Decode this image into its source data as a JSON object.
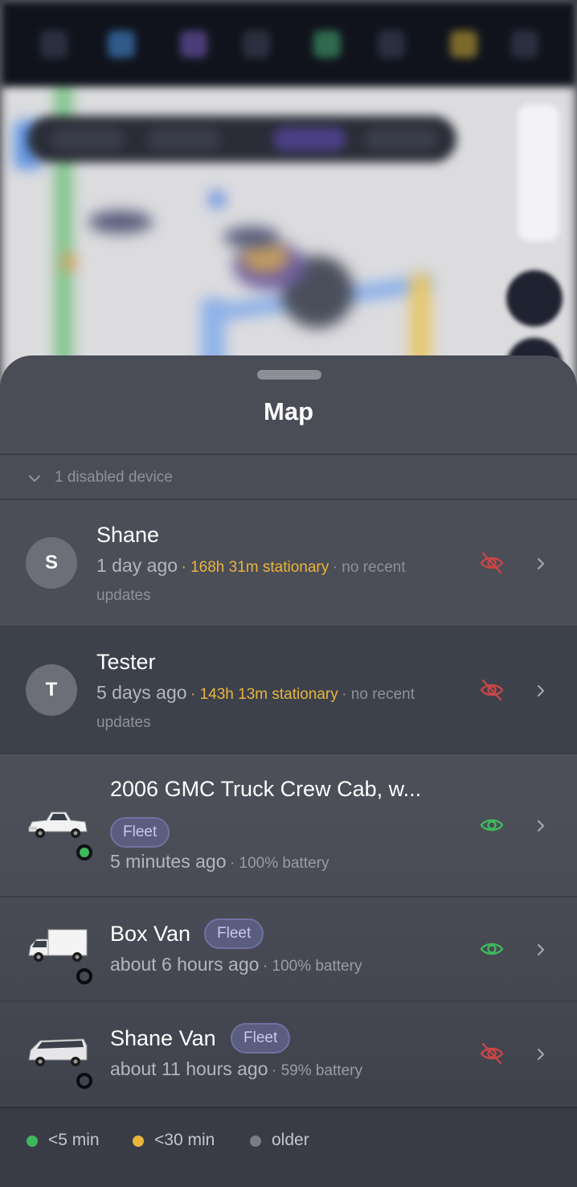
{
  "sheet": {
    "title": "Map"
  },
  "disabled": {
    "label": "1 disabled device"
  },
  "devices": [
    {
      "avatar": "S",
      "name": "Shane",
      "time": "1 day ago",
      "stationary": "· 168h 31m stationary",
      "note": "· no recent updates",
      "visibility": "hidden",
      "icon": "eye-off-icon"
    },
    {
      "avatar": "T",
      "name": "Tester",
      "time": "5 days ago",
      "stationary": "· 143h 13m stationary",
      "note": "· no recent updates",
      "visibility": "hidden",
      "icon": "eye-off-icon"
    }
  ],
  "vehicles": [
    {
      "name": "2006 GMC Truck Crew Cab, w...",
      "badge": "Fleet",
      "time": "5 minutes ago",
      "battery": "· 100% battery",
      "status": "green",
      "visibility": "visible",
      "icon": "eye-icon"
    },
    {
      "name": "Box Van",
      "badge": "Fleet",
      "time": "about 6 hours ago",
      "battery": "· 100% battery",
      "status": "none",
      "visibility": "visible",
      "icon": "eye-icon"
    },
    {
      "name": "Shane Van",
      "badge": "Fleet",
      "time": "about 11 hours ago",
      "battery": "· 59% battery",
      "status": "none",
      "visibility": "hidden",
      "icon": "eye-off-icon"
    }
  ],
  "legend": [
    {
      "label": "<5 min",
      "color": "#3fb85c"
    },
    {
      "label": "<30 min",
      "color": "#e8b63c"
    },
    {
      "label": "older",
      "color": "#7a7c85"
    }
  ],
  "colors": {
    "visible": "#3fb85c",
    "hidden": "#c74646",
    "stationary": "#e8b63c",
    "fleet_badge": "#5a5d7e"
  }
}
